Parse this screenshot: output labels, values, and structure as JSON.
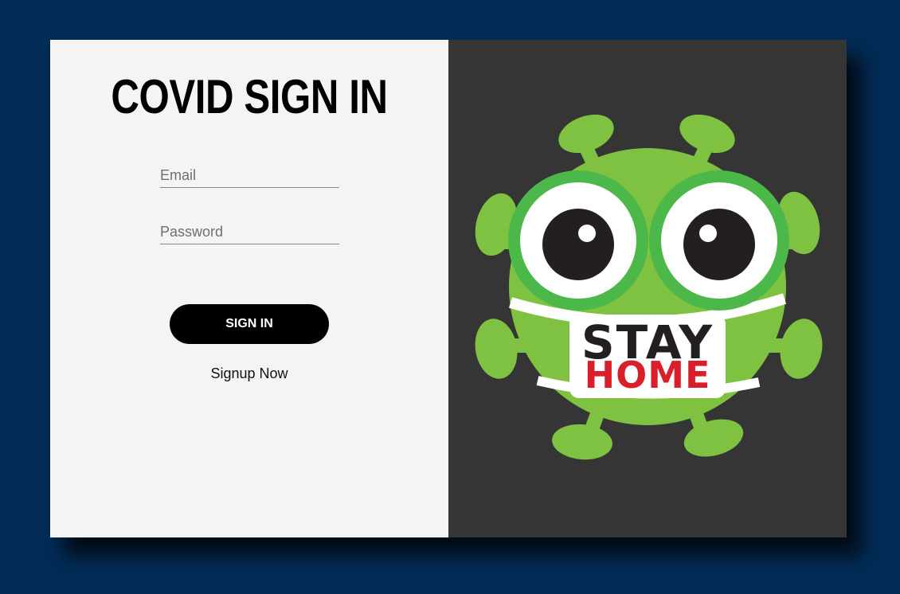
{
  "login": {
    "title": "COVID SIGN IN",
    "email_placeholder": "Email",
    "password_placeholder": "Password",
    "signin_label": "SIGN IN",
    "signup_label": "Signup Now"
  },
  "illustration": {
    "mask_line1": "STAY",
    "mask_line2": "HOME",
    "icon": "virus-mascot-icon"
  },
  "colors": {
    "page_bg": "#022b55",
    "left_panel_bg": "#f4f4f4",
    "right_panel_bg": "#353535",
    "virus_green": "#7fc241",
    "home_red": "#d81f2a"
  }
}
